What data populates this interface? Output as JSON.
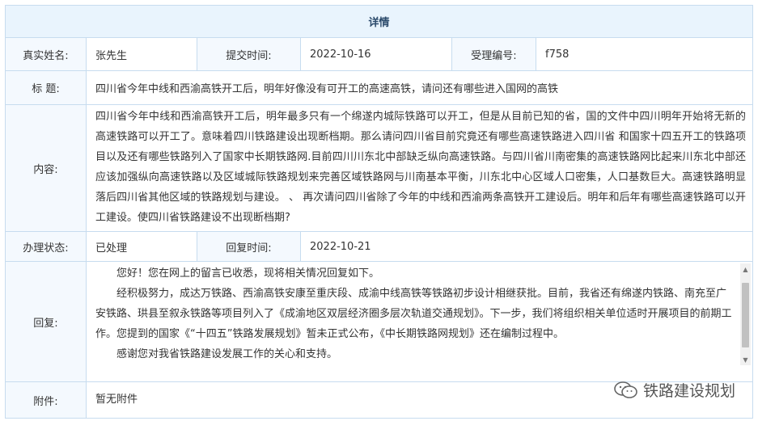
{
  "header": {
    "title": "详情"
  },
  "info": {
    "name_label": "真实姓名:",
    "name_value": "张先生",
    "submit_label": "提交时间:",
    "submit_value": "2022-10-16",
    "accept_label": "受理编号:",
    "accept_value": "f758"
  },
  "subject": {
    "label": "标 题:",
    "value": "四川省今年中线和西渝高铁开工后，明年好像没有可开工的高速高铁，请问还有哪些进入国网的高铁"
  },
  "content": {
    "label": "内容:",
    "value": "四川省今年中线和西渝高铁开工后，明年最多只有一个绵遂内城际铁路可以开工，但是从目前已知的省，国的文件中四川明年开始将无新的高速铁路可以开工了。意味着四川铁路建设出现断档期。那么请问四川省目前究竟还有哪些高速铁路进入四川省 和国家十四五开工的铁路项目以及还有哪些铁路列入了国家中长期铁路网.目前四川川东北中部缺乏纵向高速铁路。与四川省川南密集的高速铁路网比起来川东北中部还应该加强纵向高速铁路以及区域城际铁路规划来完善区域铁路网与川南基本平衡，川东北中心区域人口密集，人口基数巨大。高速铁路明显落后四川省其他区域的铁路规划与建设。 、 再次请问四川省除了今年的中线和西渝两条高铁开工建设后。明年和后年有哪些高速铁路可以开工建设。使四川省铁路建设不出现断档期?"
  },
  "status": {
    "label": "办理状态:",
    "value": "已处理",
    "reply_time_label": "回复时间:",
    "reply_time_value": "2022-10-21"
  },
  "reply": {
    "label": "回复:",
    "paragraphs": [
      "您好！您在网上的留言已收悉，现将相关情况回复如下。",
      "经积极努力，成达万铁路、西渝高铁安康至重庆段、成渝中线高铁等铁路初步设计相继获批。目前，我省还有绵遂内铁路、南充至广安铁路、珙县至叙永铁路等项目列入了《成渝地区双层经济圈多层次轨道交通规划》。下一步，我们将组织相关单位适时开展项目的前期工作。您提到的国家《“十四五”铁路发展规划》暂未正式公布，《中长期铁路网规划》还在编制过程中。",
      "感谢您对我省铁路建设发展工作的关心和支持。"
    ]
  },
  "attachment": {
    "label": "附件:",
    "value": "暂无附件"
  },
  "watermark": {
    "text": "铁路建设规划",
    "icon": "wechat-icon"
  }
}
